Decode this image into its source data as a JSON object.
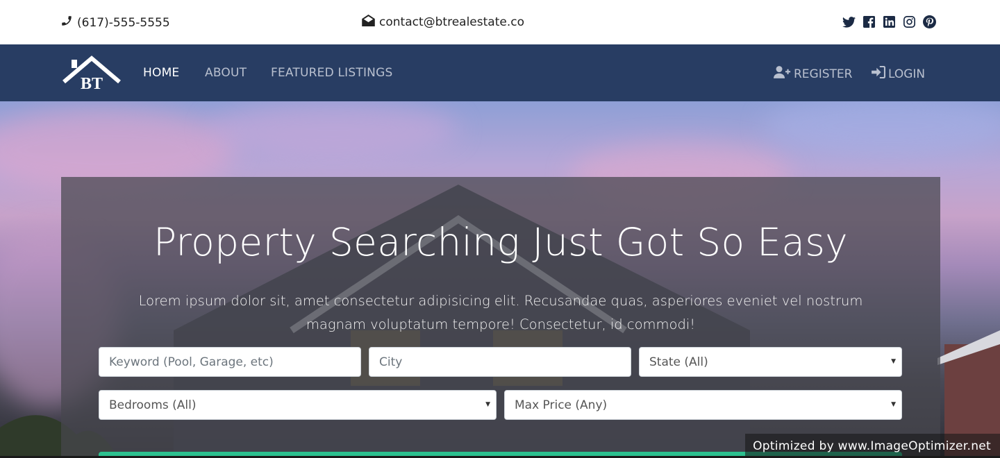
{
  "topbar": {
    "phone": "(617)-555-5555",
    "email": "contact@btrealestate.co",
    "socials": [
      "twitter-icon",
      "facebook-icon",
      "linkedin-icon",
      "instagram-icon",
      "pinterest-icon"
    ]
  },
  "navbar": {
    "logo_text": "BT",
    "links": [
      {
        "label": "HOME",
        "active": true
      },
      {
        "label": "ABOUT",
        "active": false
      },
      {
        "label": "FEATURED LISTINGS",
        "active": false
      }
    ],
    "register_label": "REGISTER",
    "login_label": "LOGIN"
  },
  "hero": {
    "title": "Property Searching Just Got So Easy",
    "subtitle": "Lorem ipsum dolor sit, amet consectetur adipisicing elit. Recusandae quas, asperiores eveniet vel nostrum magnam voluptatum tempore! Consectetur, id commodi!",
    "keyword_placeholder": "Keyword (Pool, Garage, etc)",
    "city_placeholder": "City",
    "state_selected": "State (All)",
    "bedrooms_selected": "Bedrooms (All)",
    "max_price_selected": "Max Price (Any)"
  },
  "watermark": "Optimized by www.ImageOptimizer.net",
  "colors": {
    "navbar_bg": "#283d63",
    "accent": "#2cc18f"
  }
}
